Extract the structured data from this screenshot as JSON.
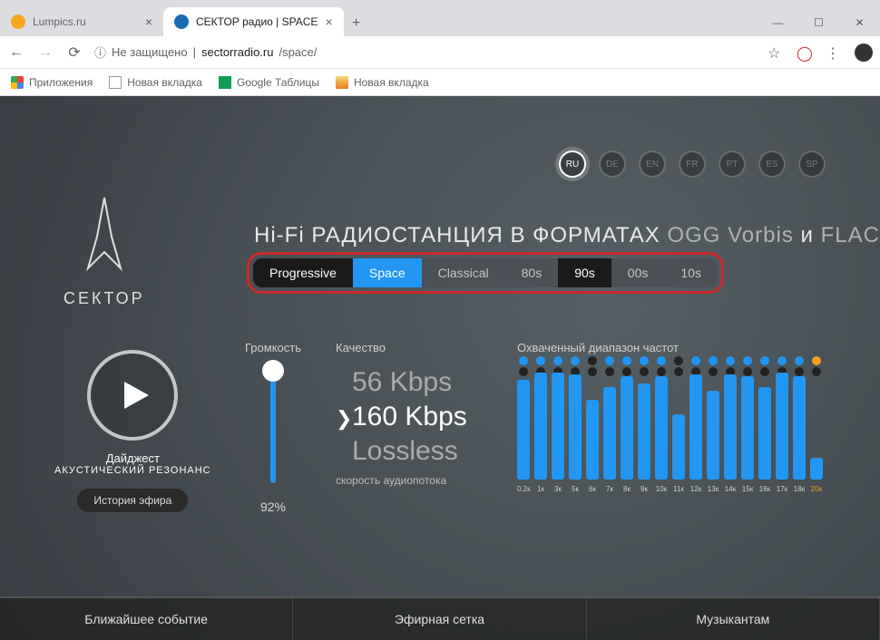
{
  "browser": {
    "tabs": [
      {
        "title": "Lumpics.ru",
        "favicon_color": "#f5a623",
        "active": false
      },
      {
        "title": "СЕКТОР радио | SPACE",
        "favicon_color": "#1a6bb0",
        "active": true
      }
    ],
    "back_enabled": true,
    "insecure_label": "Не защищено",
    "url_host": "sectorradio.ru",
    "url_path": "/space/",
    "bookmarks_label": "Приложения",
    "bookmarks": [
      {
        "label": "Новая вкладка",
        "color": "#777"
      },
      {
        "label": "Google Таблицы",
        "color": "#0f9d58"
      },
      {
        "label": "Новая вкладка",
        "color": "#f5a623"
      }
    ]
  },
  "page": {
    "langs": [
      "RU",
      "DE",
      "EN",
      "FR",
      "PT",
      "ES",
      "SP"
    ],
    "lang_active_index": 0,
    "brand": "СЕКТОР",
    "headline_a": "Hi-Fi РАДИОСТАНЦИЯ В ФОРМАТАХ ",
    "headline_b": "OGG Vorbis",
    "headline_c": " и ",
    "headline_d": "FLAC",
    "genres": [
      {
        "label": "Progressive",
        "variant": "dark"
      },
      {
        "label": "Space",
        "variant": "sel"
      },
      {
        "label": "Classical",
        "variant": ""
      },
      {
        "label": "80s",
        "variant": ""
      },
      {
        "label": "90s",
        "variant": "dark"
      },
      {
        "label": "00s",
        "variant": ""
      },
      {
        "label": "10s",
        "variant": ""
      }
    ],
    "digest_title": "Дайджест",
    "digest_sub": "АКУСТИЧЕСКИЙ РЕЗОНАНС",
    "history_btn": "История эфира",
    "volume_label": "Громкость",
    "volume_pct": "92%",
    "quality_label": "Качество",
    "quality_rows": [
      {
        "val": "56 Kbps",
        "sel": false
      },
      {
        "val": "160 Kbps",
        "sel": true
      },
      {
        "val": "Lossless",
        "sel": false
      }
    ],
    "quality_sub": "скорость аудиопотока",
    "freq_label": "Охваченный диапазон частот",
    "bottom_nav": [
      "Ближайшее событие",
      "Эфирная сетка",
      "Музыкантам"
    ]
  },
  "chart_data": {
    "type": "bar",
    "title": "Охваченный диапазон частот",
    "categories": [
      "0.2к",
      "1к",
      "3к",
      "5к",
      "6к",
      "7к",
      "8к",
      "9к",
      "10к",
      "11к",
      "12к",
      "13к",
      "14к",
      "15к",
      "16к",
      "17к",
      "18к",
      "20к"
    ],
    "values": [
      92,
      98,
      98,
      97,
      73,
      85,
      95,
      88,
      95,
      60,
      97,
      82,
      97,
      95,
      85,
      98,
      95,
      20
    ],
    "dot_colors": [
      "#2196f3",
      "#2196f3",
      "#2196f3",
      "#2196f3",
      "#222",
      "#2196f3",
      "#2196f3",
      "#2196f3",
      "#2196f3",
      "#222",
      "#2196f3",
      "#2196f3",
      "#2196f3",
      "#2196f3",
      "#2196f3",
      "#2196f3",
      "#2196f3",
      "#f0a020"
    ],
    "ylim": [
      0,
      100
    ],
    "xlabel": "",
    "ylabel": ""
  }
}
